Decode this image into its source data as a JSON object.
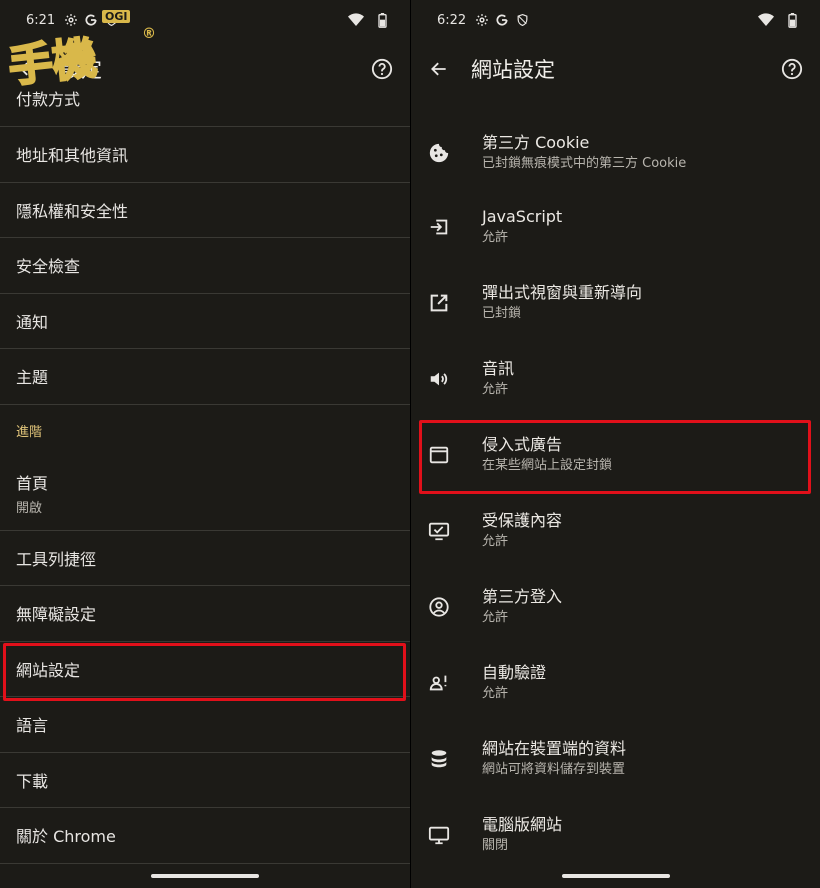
{
  "left": {
    "status": {
      "time": "6:21"
    },
    "appbar": {
      "title": "設定"
    },
    "rows": [
      {
        "label": "付款方式",
        "partial": true
      },
      {
        "label": "地址和其他資訊"
      },
      {
        "label": "隱私權和安全性"
      },
      {
        "label": "安全檢查"
      },
      {
        "label": "通知"
      },
      {
        "label": "主題"
      },
      {
        "label": "進階",
        "section": true
      },
      {
        "label": "首頁",
        "sub": "開啟"
      },
      {
        "label": "工具列捷徑"
      },
      {
        "label": "無障礙設定"
      },
      {
        "label": "網站設定",
        "highlighted": true
      },
      {
        "label": "語言"
      },
      {
        "label": "下載"
      },
      {
        "label": "關於 Chrome"
      }
    ]
  },
  "right": {
    "status": {
      "time": "6:22"
    },
    "appbar": {
      "title": "網站設定"
    },
    "items": [
      {
        "icon": "cookie-icon",
        "title": "第三方 Cookie",
        "sub": "已封鎖無痕模式中的第三方 Cookie"
      },
      {
        "icon": "javascript-icon",
        "title": "JavaScript",
        "sub": "允許"
      },
      {
        "icon": "popup-icon",
        "title": "彈出式視窗與重新導向",
        "sub": "已封鎖"
      },
      {
        "icon": "sound-icon",
        "title": "音訊",
        "sub": "允許"
      },
      {
        "icon": "ads-icon",
        "title": "侵入式廣告",
        "sub": "在某些網站上設定封鎖",
        "highlighted": true
      },
      {
        "icon": "protected-content-icon",
        "title": "受保護內容",
        "sub": "允許"
      },
      {
        "icon": "account-icon",
        "title": "第三方登入",
        "sub": "允許"
      },
      {
        "icon": "auto-verify-icon",
        "title": "自動驗證",
        "sub": "允許"
      },
      {
        "icon": "database-icon",
        "title": "網站在裝置端的資料",
        "sub": "網站可將資料儲存到裝置"
      },
      {
        "icon": "desktop-icon",
        "title": "電腦版網站",
        "sub": "關閉"
      }
    ]
  },
  "logo": {
    "text": "手機",
    "badge": "OGI",
    "reg": "®"
  },
  "colors": {
    "background": "#1c1b17",
    "text": "#e8e6e3",
    "section": "#e0c47a",
    "highlight": "#e1101a",
    "divider": "#3a3934"
  }
}
